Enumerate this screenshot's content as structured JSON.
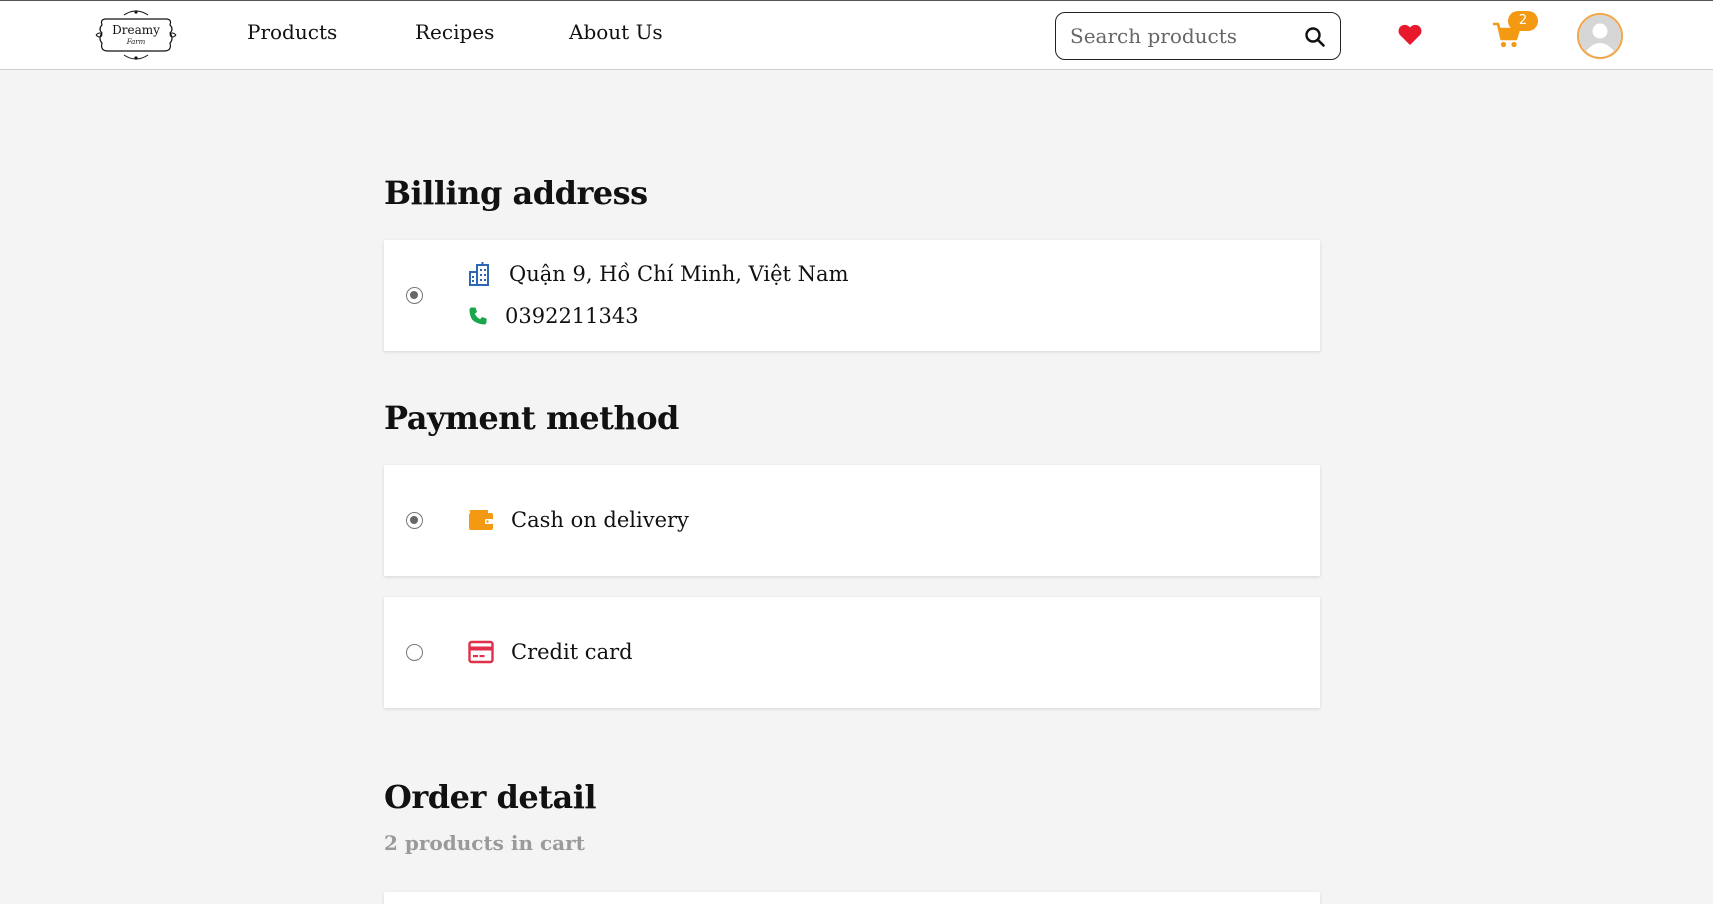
{
  "header": {
    "logo": {
      "main": "Dreamy",
      "sub": "Farm"
    },
    "nav": [
      "Products",
      "Recipes",
      "About Us"
    ],
    "search": {
      "placeholder": "Search products",
      "value": ""
    },
    "cart_count": "2",
    "icons": [
      "search-icon",
      "heart-icon",
      "cart-icon",
      "avatar-icon"
    ]
  },
  "billing": {
    "title": "Billing address",
    "address": "Quận 9, Hồ Chí Minh, Việt Nam",
    "phone": "0392211343",
    "selected": true
  },
  "payment": {
    "title": "Payment method",
    "options": [
      {
        "label": "Cash on delivery",
        "icon": "wallet-icon",
        "selected": true
      },
      {
        "label": "Credit card",
        "icon": "credit-card-icon",
        "selected": false
      }
    ]
  },
  "order": {
    "title": "Order detail",
    "subtitle": "2 products in cart"
  },
  "colors": {
    "accent_orange": "#f39a12",
    "heart_red": "#e8192c",
    "phone_green": "#1aa64a",
    "building_blue": "#2f66b3",
    "card_red": "#e0304a",
    "background": "#f4f4f4"
  }
}
